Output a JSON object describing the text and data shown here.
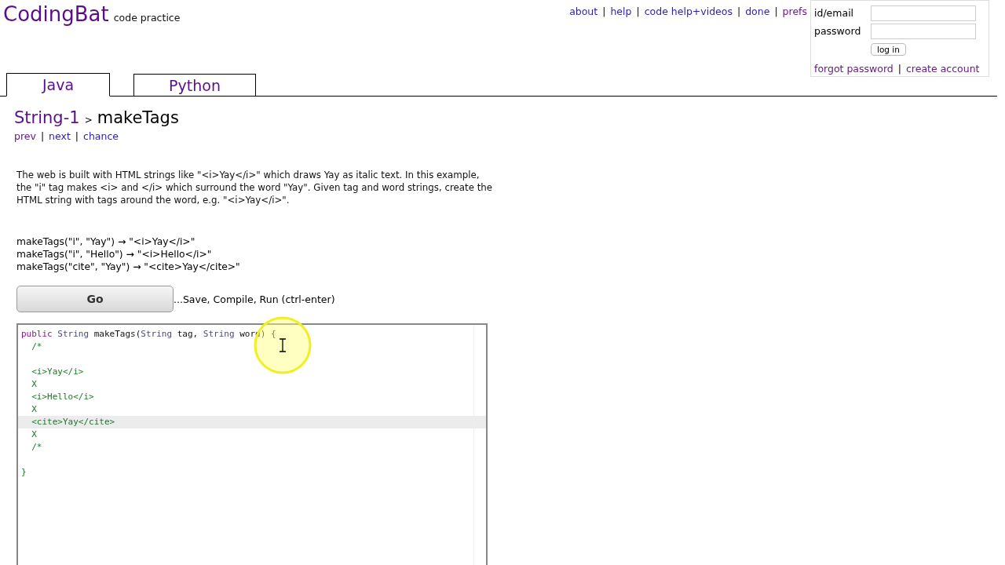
{
  "logo": {
    "name": "CodingBat",
    "tagline": "code practice"
  },
  "top_links": [
    {
      "label": "about",
      "visited": false
    },
    {
      "separator": "|",
      "label": "help",
      "visited": false
    },
    {
      "separator": "|",
      "label": "code help+videos",
      "visited": false
    },
    {
      "separator": "|",
      "label": "done",
      "visited": false
    },
    {
      "separator": "|",
      "label": "prefs",
      "visited": true
    }
  ],
  "login": {
    "fields": [
      {
        "label": "id/email"
      },
      {
        "label": "password"
      }
    ],
    "button": "log in",
    "links": [
      {
        "label": "forgot password"
      },
      {
        "separator": "|",
        "label": "create account"
      }
    ]
  },
  "tabs": [
    {
      "label": "Java",
      "selected": true
    },
    {
      "label": "Python",
      "selected": false
    }
  ],
  "breadcrumb": {
    "section": "String-1",
    "separator": ">",
    "problem": "makeTags"
  },
  "nav_links": [
    {
      "label": "prev",
      "visited": true
    },
    {
      "separator": "|",
      "label": "next",
      "visited": false
    },
    {
      "separator": "|",
      "label": "chance",
      "visited": false
    }
  ],
  "description": "The web is built with HTML strings like \"<i>Yay</i>\" which draws Yay as italic text. In this example, the \"i\" tag makes <i> and </i> which surround the word \"Yay\". Given tag and word strings, create the HTML string with tags around the word, e.g. \"<i>Yay</i>\".",
  "examples": [
    "makeTags(\"i\", \"Yay\") → \"<i>Yay</i>\"",
    "makeTags(\"i\", \"Hello\") → \"<i>Hello</i>\"",
    "makeTags(\"cite\", \"Yay\") → \"<cite>Yay</cite>\""
  ],
  "go_button": "Go",
  "go_hint": "...Save, Compile, Run (ctrl-enter)",
  "editor": {
    "lines": [
      {
        "highlighted": false,
        "tokens": [
          {
            "text": "public",
            "kind": "keyword"
          },
          {
            "text": " String",
            "kind": "type"
          },
          {
            "text": " makeTags(",
            "kind": "plain"
          },
          {
            "text": "String",
            "kind": "type"
          },
          {
            "text": " tag, ",
            "kind": "plain"
          },
          {
            "text": "String",
            "kind": "type"
          },
          {
            "text": " word) {",
            "kind": "plain"
          }
        ]
      },
      {
        "highlighted": false,
        "tokens": [
          {
            "text": "  /*",
            "kind": "comment"
          }
        ]
      },
      {
        "kind": "blank"
      },
      {
        "highlighted": false,
        "tokens": [
          {
            "text": "  <i>Yay</i>",
            "kind": "comment"
          }
        ]
      },
      {
        "highlighted": false,
        "tokens": [
          {
            "text": "  X",
            "kind": "comment"
          }
        ]
      },
      {
        "highlighted": false,
        "tokens": [
          {
            "text": "  <i>Hello</i>",
            "kind": "comment"
          }
        ]
      },
      {
        "highlighted": false,
        "tokens": [
          {
            "text": "  X",
            "kind": "comment"
          }
        ]
      },
      {
        "highlighted": true,
        "tokens": [
          {
            "text": "  <cite>Yay</cite>",
            "kind": "comment"
          }
        ]
      },
      {
        "highlighted": false,
        "tokens": [
          {
            "text": "  X",
            "kind": "comment"
          }
        ]
      },
      {
        "highlighted": false,
        "tokens": [
          {
            "text": "  /*",
            "kind": "comment"
          }
        ]
      },
      {
        "kind": "blank"
      },
      {
        "highlighted": false,
        "tokens": [
          {
            "text": "}",
            "kind": "comment"
          }
        ]
      }
    ]
  }
}
